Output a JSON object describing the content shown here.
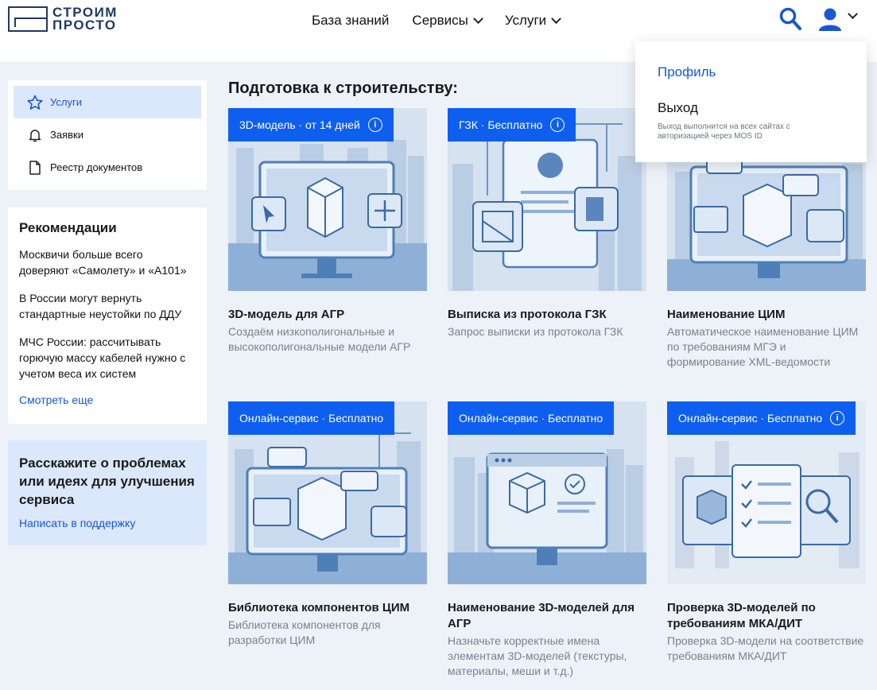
{
  "header": {
    "logo_line1": "СТРОИМ",
    "logo_line2": "ПРОСТО",
    "nav": [
      "База знаний",
      "Сервисы",
      "Услуги"
    ]
  },
  "sidebar": {
    "items": [
      {
        "label": "Услуги",
        "icon": "star-icon"
      },
      {
        "label": "Заявки",
        "icon": "bell-icon"
      },
      {
        "label": "Реестр документов",
        "icon": "document-icon"
      }
    ]
  },
  "recommendations": {
    "title": "Рекомендации",
    "items": [
      "Москвичи больше всего доверяют «Самолету» и «А101»",
      "В России могут вернуть стандартные неустойки по ДДУ",
      "МЧС России: рассчитывать горючую массу кабелей нужно с учетом веса их систем"
    ],
    "more": "Смотреть еще"
  },
  "feedback": {
    "title": "Расскажите о проблемах или идеях для улучшения сервиса",
    "link": "Написать в поддержку"
  },
  "main": {
    "title": "Подготовка к строительству:",
    "cards": [
      {
        "badge": "3D-модель · от 14 дней",
        "info": true,
        "title": "3D-модель для АГР",
        "desc": "Создаём низкополигональные и высокополигональные модели АГР"
      },
      {
        "badge": "ГЗК · Бесплатно",
        "info": true,
        "title": "Выписка из протокола ГЗК",
        "desc": "Запрос выписки из протокола ГЗК"
      },
      {
        "badge": "",
        "info": false,
        "title": "Наименование ЦИМ",
        "desc": "Автоматическое наименование ЦИМ по требованиям МГЭ и формирование XML-ведомости"
      },
      {
        "badge": "Онлайн-сервис · Бесплатно",
        "info": false,
        "title": "Библиотека компонентов ЦИМ",
        "desc": "Библиотека компонентов для разработки ЦИМ"
      },
      {
        "badge": "Онлайн-сервис · Бесплатно",
        "info": false,
        "title": "Наименование 3D-моделей для АГР",
        "desc": "Назначьте корректные имена элементам 3D-моделей (текстуры, материалы, меши и т.д.)"
      },
      {
        "badge": "Онлайн-сервис · Бесплатно",
        "info": true,
        "title": "Проверка 3D-моделей по требованиям МКА/ДИТ",
        "desc": "Проверка 3D-модели на соответствие требованиям МКА/ДИТ"
      }
    ]
  },
  "dropdown": {
    "profile": "Профиль",
    "logout": "Выход",
    "note": "Выход выполнится на всех сайтах с авторизацией через MOS ID"
  },
  "colors": {
    "accent": "#0e5ff0",
    "link": "#1957d2",
    "background": "#edf2f8"
  }
}
